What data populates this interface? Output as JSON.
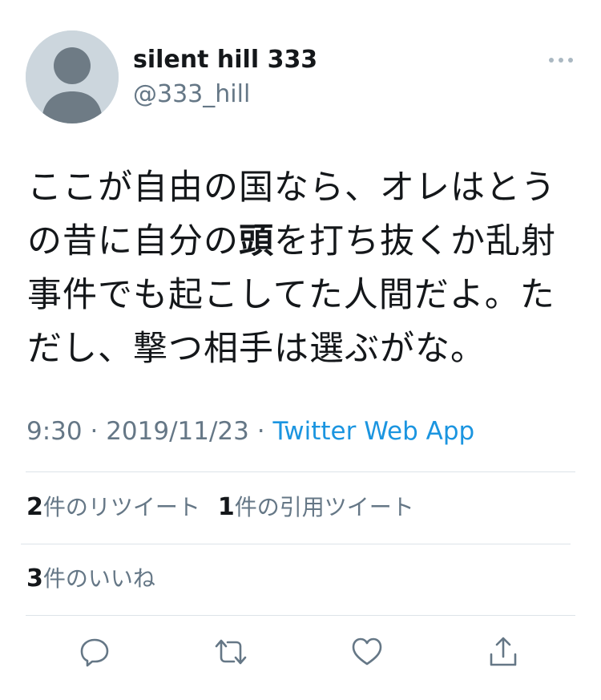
{
  "user": {
    "display_name": "silent hill 333",
    "handle": "@333_hill"
  },
  "tweet": {
    "text_before": "ここが自由の国なら、オレはとうの昔に自分の",
    "text_bold": "頭",
    "text_after": "を打ち抜くか乱射事件でも起こしてた人間だよ。ただし、撃つ相手は選ぶがな。",
    "time": "9:30",
    "separator_1": "·",
    "date": "2019/11/23",
    "separator_2": "·",
    "source": "Twitter Web App"
  },
  "stats": {
    "retweets_count": "2",
    "retweets_label": "件のリツイート",
    "quotes_count": "1",
    "quotes_label": "件の引用ツイート",
    "likes_count": "3",
    "likes_label": "件のいいね"
  },
  "icons": {
    "more": "more-icon",
    "reply": "reply-icon",
    "retweet": "retweet-icon",
    "like": "heart-icon",
    "share": "share-icon"
  },
  "colors": {
    "text": "#14171a",
    "secondary": "#657786",
    "link": "#1b95e0",
    "avatar_bg": "#ccd6dd",
    "avatar_fg": "#6e7b85",
    "icon": "#657786"
  }
}
